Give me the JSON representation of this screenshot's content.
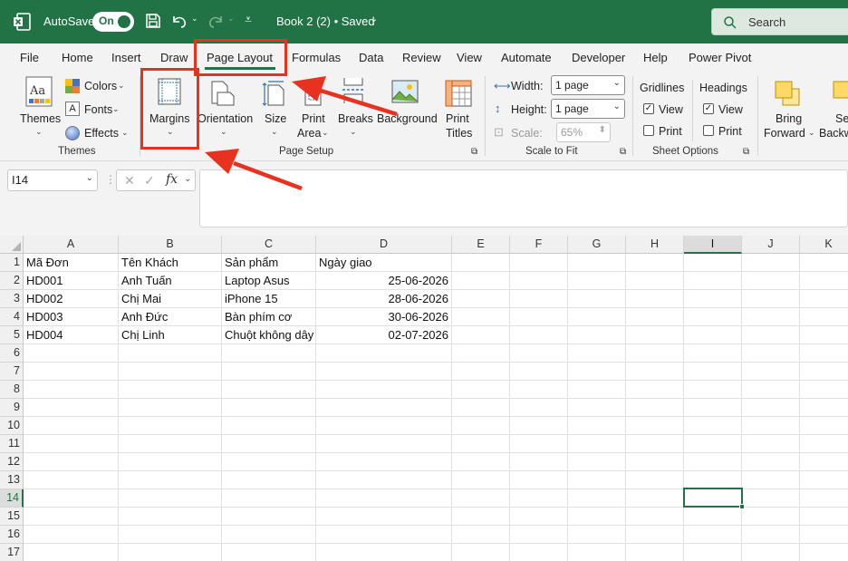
{
  "titlebar": {
    "autosave_label": "AutoSave",
    "autosave_state": "On",
    "doc_title": "Book 2 (2) • Saved",
    "search_placeholder": "Search",
    "bg_color": "#217346"
  },
  "tabs": [
    "File",
    "Home",
    "Insert",
    "Draw",
    "Page Layout",
    "Formulas",
    "Data",
    "Review",
    "View",
    "Automate",
    "Developer",
    "Help",
    "Power Pivot"
  ],
  "active_tab": "Page Layout",
  "ribbon": {
    "themes": {
      "themes": "Themes",
      "colors": "Colors",
      "fonts": "Fonts",
      "effects": "Effects",
      "group": "Themes"
    },
    "page_setup": {
      "margins": "Margins",
      "orientation": "Orientation",
      "size": "Size",
      "print": "Print",
      "area": "Area",
      "breaks": "Breaks",
      "background": "Background",
      "print2": "Print",
      "titles": "Titles",
      "group": "Page Setup"
    },
    "scale": {
      "width": "Width:",
      "width_val": "1 page",
      "height": "Height:",
      "height_val": "1 page",
      "scale": "Scale:",
      "scale_val": "65%",
      "group": "Scale to Fit"
    },
    "sheet_options": {
      "gridlines": "Gridlines",
      "headings": "Headings",
      "view": "View",
      "print": "Print",
      "group": "Sheet Options",
      "gridlines_view": true,
      "gridlines_print": false,
      "headings_view": true,
      "headings_print": false
    },
    "arrange": {
      "bring": "Bring",
      "forward": "Forward",
      "send": "Se",
      "backward": "Backw"
    }
  },
  "formula_bar": {
    "name_box": "I14",
    "fx": "fx",
    "value": ""
  },
  "columns": [
    "A",
    "B",
    "C",
    "D",
    "E",
    "F",
    "G",
    "H",
    "I",
    "J",
    "K"
  ],
  "rows": [
    "1",
    "2",
    "3",
    "4",
    "5",
    "6",
    "7",
    "8",
    "9",
    "10",
    "11",
    "12",
    "13",
    "14",
    "15",
    "16",
    "17"
  ],
  "selected_cell": "I14",
  "sheet": {
    "headers": [
      "Mã Đơn",
      "Tên Khách",
      "Sản phẩm",
      "Ngày giao"
    ],
    "data": [
      [
        "HD001",
        "Anh Tuấn",
        "Laptop Asus",
        "25-06-2026"
      ],
      [
        "HD002",
        "Chị Mai",
        "iPhone 15",
        "28-06-2026"
      ],
      [
        "HD003",
        "Anh Đức",
        "Bàn phím cơ",
        "30-06-2026"
      ],
      [
        "HD004",
        "Chị Linh",
        "Chuột không dây",
        "02-07-2026"
      ]
    ]
  },
  "annotation_color": "#e8321f"
}
